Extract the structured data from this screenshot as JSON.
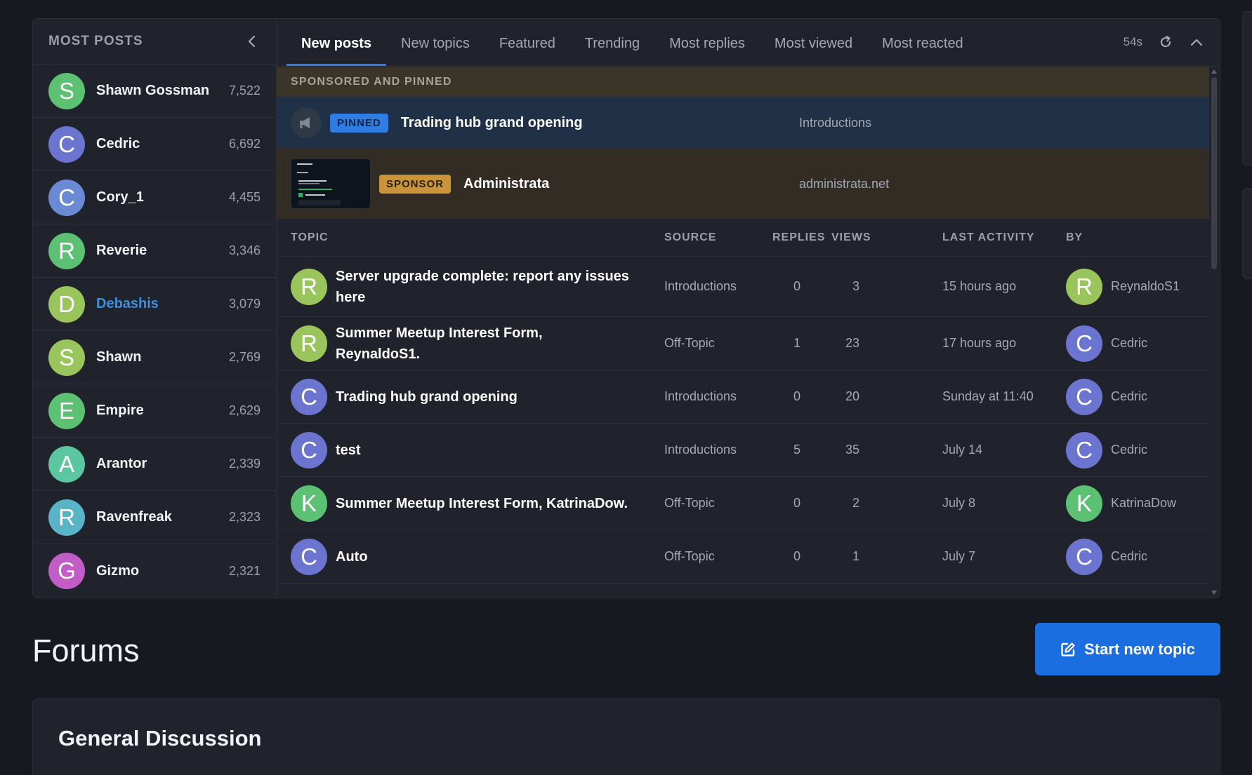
{
  "sidebar": {
    "title": "MOST POSTS",
    "members": [
      {
        "initial": "S",
        "name": "Shawn Gossman",
        "count": "7,522",
        "color": "#5cc172",
        "link": false
      },
      {
        "initial": "C",
        "name": "Cedric",
        "count": "6,692",
        "color": "#6b74cf",
        "link": false
      },
      {
        "initial": "C",
        "name": "Cory_1",
        "count": "4,455",
        "color": "#6b8ad6",
        "link": false
      },
      {
        "initial": "R",
        "name": "Reverie",
        "count": "3,346",
        "color": "#5cc172",
        "link": false
      },
      {
        "initial": "D",
        "name": "Debashis",
        "count": "3,079",
        "color": "#9ac45c",
        "link": true
      },
      {
        "initial": "S",
        "name": "Shawn",
        "count": "2,769",
        "color": "#9ac45c",
        "link": false
      },
      {
        "initial": "E",
        "name": "Empire",
        "count": "2,629",
        "color": "#5cc172",
        "link": false
      },
      {
        "initial": "A",
        "name": "Arantor",
        "count": "2,339",
        "color": "#5ac7a0",
        "link": false
      },
      {
        "initial": "R",
        "name": "Ravenfreak",
        "count": "2,323",
        "color": "#5ab4c7",
        "link": false
      },
      {
        "initial": "G",
        "name": "Gizmo",
        "count": "2,321",
        "color": "#c25cc7",
        "link": false
      }
    ]
  },
  "tabs": [
    "New posts",
    "New topics",
    "Featured",
    "Trending",
    "Most replies",
    "Most viewed",
    "Most reacted"
  ],
  "active_tab": 0,
  "timer": "54s",
  "sponsored": {
    "heading": "SPONSORED AND PINNED",
    "pinned": {
      "badge": "PINNED",
      "title": "Trading hub grand opening",
      "source": "Introductions"
    },
    "sponsor": {
      "badge": "SPONSOR",
      "title": "Administrata",
      "source": "administrata.net"
    }
  },
  "table": {
    "headers": {
      "topic": "TOPIC",
      "source": "SOURCE",
      "replies": "REPLIES",
      "views": "VIEWS",
      "last": "LAST ACTIVITY",
      "by": "BY"
    },
    "rows": [
      {
        "initial": "R",
        "color": "#9ac45c",
        "title": "Server upgrade complete: report any issues here",
        "source": "Introductions",
        "replies": "0",
        "views": "3",
        "last": "15 hours ago",
        "by_initial": "R",
        "by_color": "#9ac45c",
        "by": "ReynaldoS1"
      },
      {
        "initial": "R",
        "color": "#9ac45c",
        "title": "Summer Meetup Interest Form, ReynaldoS1.",
        "source": "Off-Topic",
        "replies": "1",
        "views": "23",
        "last": "17 hours ago",
        "by_initial": "C",
        "by_color": "#6b74cf",
        "by": "Cedric"
      },
      {
        "initial": "C",
        "color": "#6b74cf",
        "title": "Trading hub grand opening",
        "source": "Introductions",
        "replies": "0",
        "views": "20",
        "last": "Sunday at 11:40",
        "by_initial": "C",
        "by_color": "#6b74cf",
        "by": "Cedric"
      },
      {
        "initial": "C",
        "color": "#6b74cf",
        "title": "test",
        "source": "Introductions",
        "replies": "5",
        "views": "35",
        "last": "July 14",
        "by_initial": "C",
        "by_color": "#6b74cf",
        "by": "Cedric"
      },
      {
        "initial": "K",
        "color": "#5cc172",
        "title": "Summer Meetup Interest Form, KatrinaDow.",
        "source": "Off-Topic",
        "replies": "0",
        "views": "2",
        "last": "July 8",
        "by_initial": "K",
        "by_color": "#5cc172",
        "by": "KatrinaDow"
      },
      {
        "initial": "C",
        "color": "#6b74cf",
        "title": "Auto",
        "source": "Off-Topic",
        "replies": "0",
        "views": "1",
        "last": "July 7",
        "by_initial": "C",
        "by_color": "#6b74cf",
        "by": "Cedric"
      }
    ]
  },
  "forums": {
    "title": "Forums",
    "new_topic_label": "Start new topic",
    "node_title": "General Discussion"
  }
}
